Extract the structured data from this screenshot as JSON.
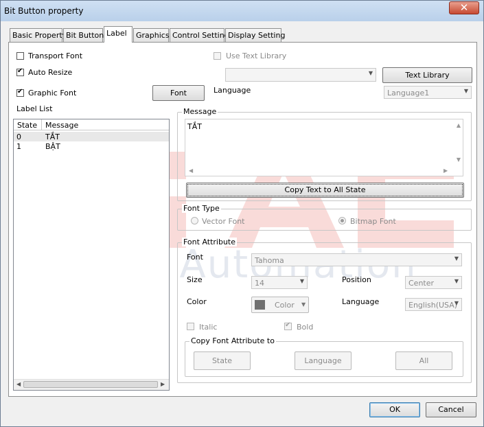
{
  "window": {
    "title": "Bit Button property",
    "close_glyph": "✕"
  },
  "tabs": [
    {
      "label": "Basic Property"
    },
    {
      "label": "Bit Button"
    },
    {
      "label": "Label"
    },
    {
      "label": "Graphics"
    },
    {
      "label": "Control Setting"
    },
    {
      "label": "Display Setting"
    }
  ],
  "options": {
    "transport_font": {
      "label": "Transport Font",
      "checked": false
    },
    "auto_resize": {
      "label": "Auto Resize",
      "checked": true
    },
    "graphic_font": {
      "label": "Graphic Font",
      "checked": true
    },
    "use_text_library": {
      "label": "Use Text Library",
      "checked": false,
      "enabled": false
    }
  },
  "font_button": "Font",
  "text_library_button": "Text Library",
  "language": {
    "label": "Language",
    "value": "Language1"
  },
  "label_list": {
    "title": "Label List",
    "headers": [
      "State",
      "Message"
    ],
    "rows": [
      {
        "state": "0",
        "message": "TẮT"
      },
      {
        "state": "1",
        "message": "BẬT"
      }
    ]
  },
  "message": {
    "title": "Message",
    "text": "TẮT",
    "copy_button": "Copy Text to All State"
  },
  "font_type": {
    "title": "Font Type",
    "vector": {
      "label": "Vector Font",
      "selected": false
    },
    "bitmap": {
      "label": "Bitmap Font",
      "selected": true
    }
  },
  "font_attribute": {
    "title": "Font Attribute",
    "font_label": "Font",
    "font_value": "Tahoma",
    "size_label": "Size",
    "size_value": "14",
    "position_label": "Position",
    "position_value": "Center",
    "color_label": "Color",
    "color_button": "Color",
    "color_swatch": "#707070",
    "language_label": "Language",
    "language_value": "English(USA)",
    "italic": {
      "label": "Italic",
      "checked": false
    },
    "bold": {
      "label": "Bold",
      "checked": true
    },
    "copy_group": {
      "title": "Copy Font Attribute to",
      "state_button": "State",
      "language_button": "Language",
      "all_button": "All"
    }
  },
  "footer": {
    "ok": "OK",
    "cancel": "Cancel"
  },
  "watermark": {
    "letters": "GAC",
    "text": "Global Automation",
    "color": "#e03a2f"
  }
}
